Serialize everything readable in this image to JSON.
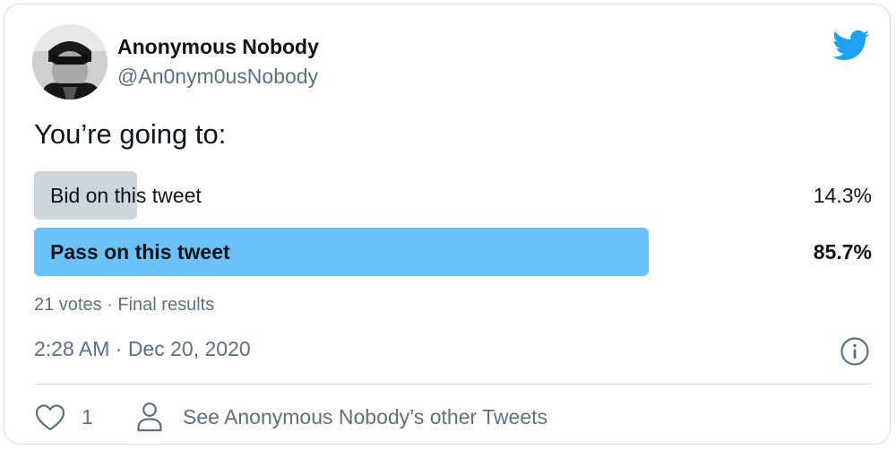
{
  "author": {
    "name": "Anonymous Nobody",
    "handle": "@An0nym0usNobody",
    "avatar_icon": "profile-photo"
  },
  "brand": {
    "icon": "twitter-bird-icon",
    "color": "#1da1f2"
  },
  "poll": {
    "question": "You’re going to:",
    "options": [
      {
        "label": "Bid on this tweet",
        "percent_text": "14.3%",
        "percent": 14.3,
        "winner": false,
        "bar_color": "#ccd6dd"
      },
      {
        "label": "Pass on this tweet",
        "percent_text": "85.7%",
        "percent": 85.7,
        "winner": true,
        "bar_color": "#6bc1fa"
      }
    ],
    "meta": "21 votes · Final results"
  },
  "timestamp": "2:28 AM · Dec 20, 2020",
  "actions": {
    "like_count": "1",
    "other_tweets": "See Anonymous Nobody’s other Tweets"
  }
}
